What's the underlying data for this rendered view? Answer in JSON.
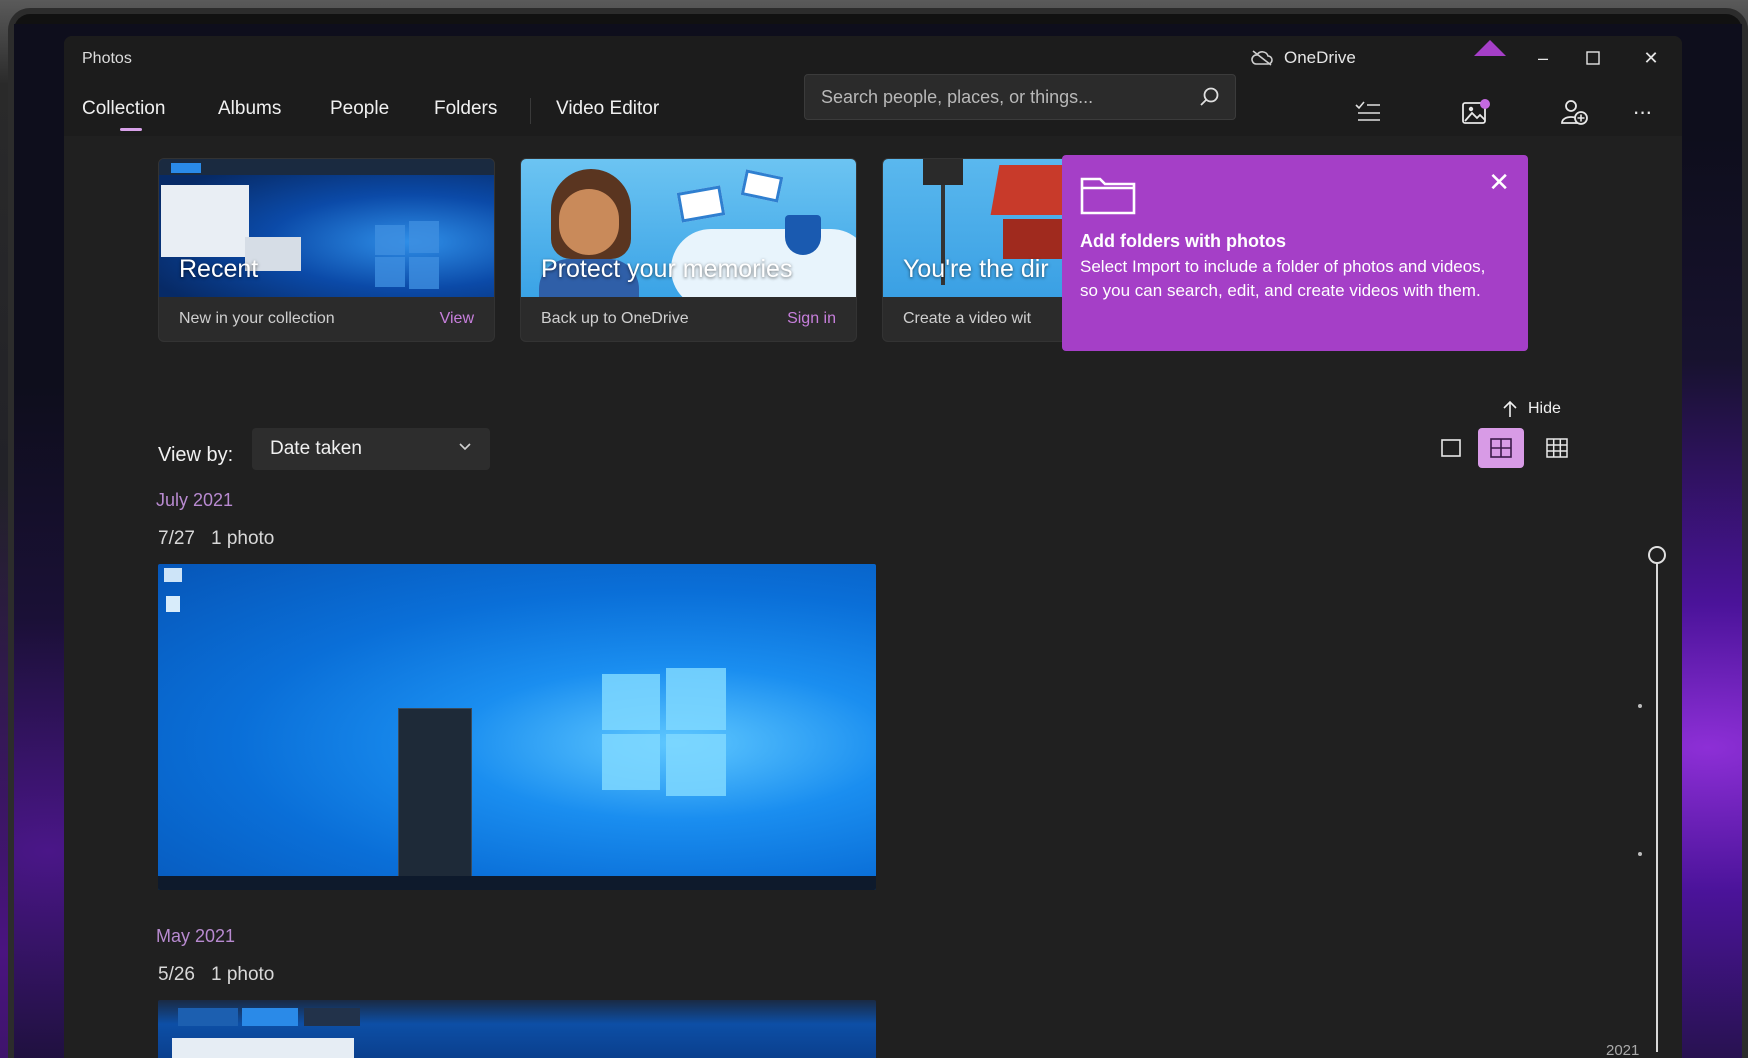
{
  "window": {
    "app_title": "Photos",
    "onedrive_label": "OneDrive",
    "minimize": "–",
    "maximize": "☐",
    "close": "✕"
  },
  "nav": {
    "tabs": [
      {
        "label": "Collection",
        "active": true
      },
      {
        "label": "Albums"
      },
      {
        "label": "People"
      },
      {
        "label": "Folders"
      },
      {
        "label": "Video Editor"
      }
    ]
  },
  "search": {
    "placeholder": "Search people, places, or things..."
  },
  "toolbar": {
    "icons": [
      "select-list-icon",
      "import-icon",
      "people-add-icon",
      "more-icon"
    ],
    "more": "···"
  },
  "cards": [
    {
      "title": "Recent",
      "subtitle": "New in your collection",
      "link": "View"
    },
    {
      "title": "Protect your memories",
      "subtitle": "Back up to OneDrive",
      "link": "Sign in"
    },
    {
      "title": "You're the dir",
      "subtitle": "Create a video wit",
      "link": ""
    }
  ],
  "teaching_tip": {
    "heading": "Add folders with photos",
    "body": "Select Import to include a folder of photos and videos, so you can search, edit, and create videos with them.",
    "close": "✕"
  },
  "hide_label": "Hide",
  "view_by": {
    "label": "View by:",
    "selected": "Date taken"
  },
  "groups": [
    {
      "month": "July 2021",
      "date": "7/27",
      "count": "1 photo"
    },
    {
      "month": "May 2021",
      "date": "5/26",
      "count": "1 photo"
    }
  ],
  "timeline": {
    "year": "2021"
  },
  "colors": {
    "accent": "#a53fc7",
    "accent_text": "#c77fdc",
    "month_text": "#b88ad0",
    "window_bg": "#202020"
  }
}
